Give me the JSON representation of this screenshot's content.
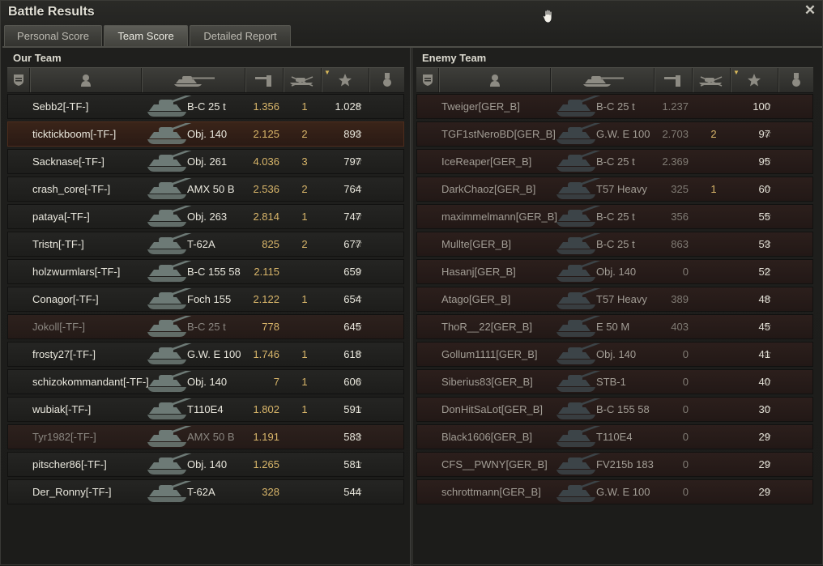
{
  "window": {
    "title": "Battle Results"
  },
  "tabs": [
    {
      "label": "Personal Score",
      "active": false
    },
    {
      "label": "Team Score",
      "active": true
    },
    {
      "label": "Detailed Report",
      "active": false
    }
  ],
  "our_team": {
    "title": "Our Team",
    "rows": [
      {
        "name": "Sebb2[-TF-]",
        "tank": "B-C 25 t",
        "damage": "1.356",
        "kills": "1",
        "xp": "1.028",
        "state": "normal"
      },
      {
        "name": "ticktickboom[-TF-]",
        "tank": "Obj. 140",
        "damage": "2.125",
        "kills": "2",
        "xp": "893",
        "state": "highlight"
      },
      {
        "name": "Sacknase[-TF-]",
        "tank": "Obj. 261",
        "damage": "4.036",
        "kills": "3",
        "xp": "797",
        "state": "normal"
      },
      {
        "name": "crash_core[-TF-]",
        "tank": "AMX 50 B",
        "damage": "2.536",
        "kills": "2",
        "xp": "764",
        "state": "normal"
      },
      {
        "name": "pataya[-TF-]",
        "tank": "Obj. 263",
        "damage": "2.814",
        "kills": "1",
        "xp": "747",
        "state": "normal"
      },
      {
        "name": "Tristn[-TF-]",
        "tank": "T-62A",
        "damage": "825",
        "kills": "2",
        "xp": "677",
        "state": "normal"
      },
      {
        "name": "holzwurmlars[-TF-]",
        "tank": "B-C 155 58",
        "damage": "2.115",
        "kills": "",
        "xp": "659",
        "state": "normal"
      },
      {
        "name": "Conagor[-TF-]",
        "tank": "Foch 155",
        "damage": "2.122",
        "kills": "1",
        "xp": "654",
        "state": "normal"
      },
      {
        "name": "Jokoll[-TF-]",
        "tank": "B-C 25 t",
        "damage": "778",
        "kills": "",
        "xp": "645",
        "state": "dead"
      },
      {
        "name": "frosty27[-TF-]",
        "tank": "G.W. E 100",
        "damage": "1.746",
        "kills": "1",
        "xp": "618",
        "state": "normal"
      },
      {
        "name": "schizokommandant[-TF-]",
        "tank": "Obj. 140",
        "damage": "7",
        "kills": "1",
        "xp": "606",
        "state": "normal"
      },
      {
        "name": "wubiak[-TF-]",
        "tank": "T110E4",
        "damage": "1.802",
        "kills": "1",
        "xp": "591",
        "state": "normal"
      },
      {
        "name": "Tyr1982[-TF-]",
        "tank": "AMX 50 B",
        "damage": "1.191",
        "kills": "",
        "xp": "583",
        "state": "dead"
      },
      {
        "name": "pitscher86[-TF-]",
        "tank": "Obj. 140",
        "damage": "1.265",
        "kills": "",
        "xp": "581",
        "state": "normal"
      },
      {
        "name": "Der_Ronny[-TF-]",
        "tank": "T-62A",
        "damage": "328",
        "kills": "",
        "xp": "544",
        "state": "normal"
      }
    ]
  },
  "enemy_team": {
    "title": "Enemy Team",
    "rows": [
      {
        "name": "Tweiger[GER_B]",
        "tank": "B-C 25 t",
        "damage": "1.237",
        "kills": "",
        "xp": "100"
      },
      {
        "name": "TGF1stNeroBD[GER_B]",
        "tank": "G.W. E 100",
        "damage": "2.703",
        "kills": "2",
        "xp": "97"
      },
      {
        "name": "IceReaper[GER_B]",
        "tank": "B-C 25 t",
        "damage": "2.369",
        "kills": "",
        "xp": "95"
      },
      {
        "name": "DarkChaoz[GER_B]",
        "tank": "T57 Heavy",
        "damage": "325",
        "kills": "1",
        "xp": "60"
      },
      {
        "name": "maximmelmann[GER_B]",
        "tank": "B-C 25 t",
        "damage": "356",
        "kills": "",
        "xp": "55"
      },
      {
        "name": "Mullte[GER_B]",
        "tank": "B-C 25 t",
        "damage": "863",
        "kills": "",
        "xp": "53"
      },
      {
        "name": "Hasanj[GER_B]",
        "tank": "Obj. 140",
        "damage": "0",
        "kills": "",
        "xp": "52"
      },
      {
        "name": "Atago[GER_B]",
        "tank": "T57 Heavy",
        "damage": "389",
        "kills": "",
        "xp": "48"
      },
      {
        "name": "ThoR__22[GER_B]",
        "tank": "E 50 M",
        "damage": "403",
        "kills": "",
        "xp": "45"
      },
      {
        "name": "Gollum1111[GER_B]",
        "tank": "Obj. 140",
        "damage": "0",
        "kills": "",
        "xp": "41"
      },
      {
        "name": "Siberius83[GER_B]",
        "tank": "STB-1",
        "damage": "0",
        "kills": "",
        "xp": "40"
      },
      {
        "name": "DonHitSaLot[GER_B]",
        "tank": "B-C 155 58",
        "damage": "0",
        "kills": "",
        "xp": "30"
      },
      {
        "name": "Black1606[GER_B]",
        "tank": "T110E4",
        "damage": "0",
        "kills": "",
        "xp": "29"
      },
      {
        "name": "CFS__PWNY[GER_B]",
        "tank": "FV215b 183",
        "damage": "0",
        "kills": "",
        "xp": "29"
      },
      {
        "name": "schrottmann[GER_B]",
        "tank": "G.W. E 100",
        "damage": "0",
        "kills": "",
        "xp": "29"
      }
    ]
  },
  "icons": {
    "header": [
      "rank-shield-icon",
      "player-icon",
      "tank-icon",
      "damage-gun-icon",
      "kills-tank-icon",
      "xp-star-icon",
      "medal-icon"
    ],
    "row_xp": "star-icon",
    "close": "close-icon",
    "cursor": "hand-cursor-icon"
  },
  "colors": {
    "accent_gold": "#d9b66a",
    "highlight_row": "#3a2419",
    "dead_row": "#2d211d",
    "text": "#e9e7dd"
  }
}
